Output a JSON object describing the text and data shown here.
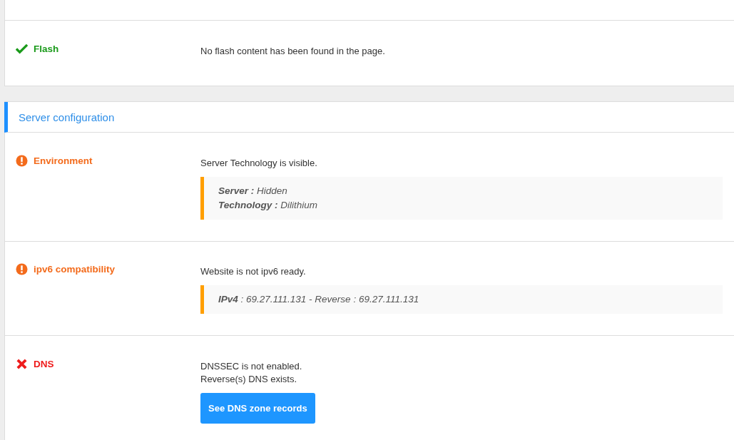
{
  "top_section": {
    "checks": [
      {
        "kind": "ok",
        "name": "Flash",
        "messages": [
          "No flash content has been found in the page."
        ]
      }
    ]
  },
  "server_configuration": {
    "title": "Server configuration",
    "checks": [
      {
        "kind": "warning",
        "name": "Environment",
        "messages": [
          "Server Technology is visible."
        ],
        "details": [
          "**Server :** Hidden",
          "**Technology :** Dilithium"
        ]
      },
      {
        "kind": "warning",
        "name": "ipv6 compatibility",
        "messages": [
          "Website is not ipv6 ready."
        ],
        "details": [
          "**IPv4** : 69.27.111.131 - Reverse : 69.27.111.131"
        ]
      },
      {
        "kind": "error",
        "name": "DNS",
        "messages": [
          "DNSSEC is not enabled.",
          "Reverse(s) DNS exists."
        ],
        "button": "See DNS zone records"
      }
    ]
  }
}
